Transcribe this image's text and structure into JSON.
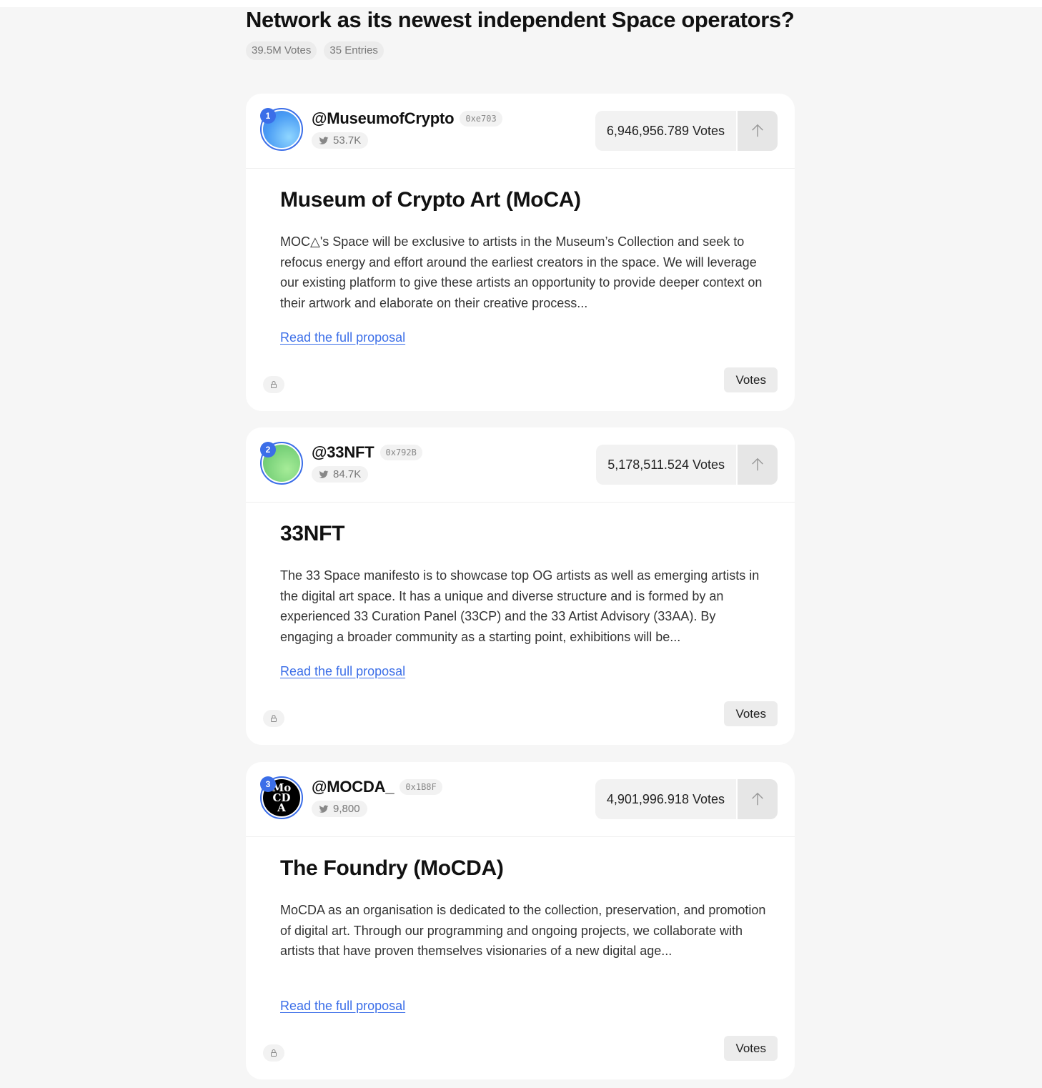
{
  "page": {
    "title": "Network as its newest independent Space operators?",
    "total_votes": "39.5M Votes",
    "entries": "35 Entries"
  },
  "entries": [
    {
      "rank": "1",
      "handle": "@MuseumofCrypto",
      "address": "0xe703",
      "followers": "53.7K",
      "votes": "6,946,956.789 Votes",
      "title": "Museum of Crypto Art (MoCA)",
      "description": "MOC△'s Space will be exclusive to artists in the Museum’s Collection and seek to refocus energy and effort around the earliest creators in the space. We will leverage our existing platform to give these artists an opportunity to provide deeper context on their artwork and elaborate on their creative process...",
      "link_label": "Read the full proposal",
      "votes_button": "Votes",
      "avatar_color": "#5fa9f5"
    },
    {
      "rank": "2",
      "handle": "@33NFT",
      "address": "0x792B",
      "followers": "84.7K",
      "votes": "5,178,511.524 Votes",
      "title": "33NFT",
      "description": "The 33 Space manifesto is to showcase top OG artists as well as emerging artists in the digital art space. It has a unique and diverse structure and is formed by an experienced 33 Curation Panel (33CP) and the 33 Artist Advisory (33AA). By engaging a broader community as a starting point, exhibitions will be...",
      "link_label": "Read the full proposal",
      "votes_button": "Votes",
      "avatar_color": "#7fd87b"
    },
    {
      "rank": "3",
      "handle": "@MOCDA_",
      "address": "0x1B8F",
      "followers": "9,800",
      "votes": "4,901,996.918 Votes",
      "title": "The Foundry (MoCDA)",
      "description": "MoCDA as an organisation is dedicated to the collection, preservation, and promotion of digital art. Through our programming and ongoing projects, we collaborate with artists that have proven themselves visionaries of a new digital age...",
      "link_label": "Read the full proposal",
      "votes_button": "Votes",
      "avatar_color": "#000000",
      "avatar_text": "MoCDA"
    }
  ],
  "colors": {
    "accent": "#3b6ee8",
    "background": "#f6f6f6",
    "card": "#ffffff"
  }
}
